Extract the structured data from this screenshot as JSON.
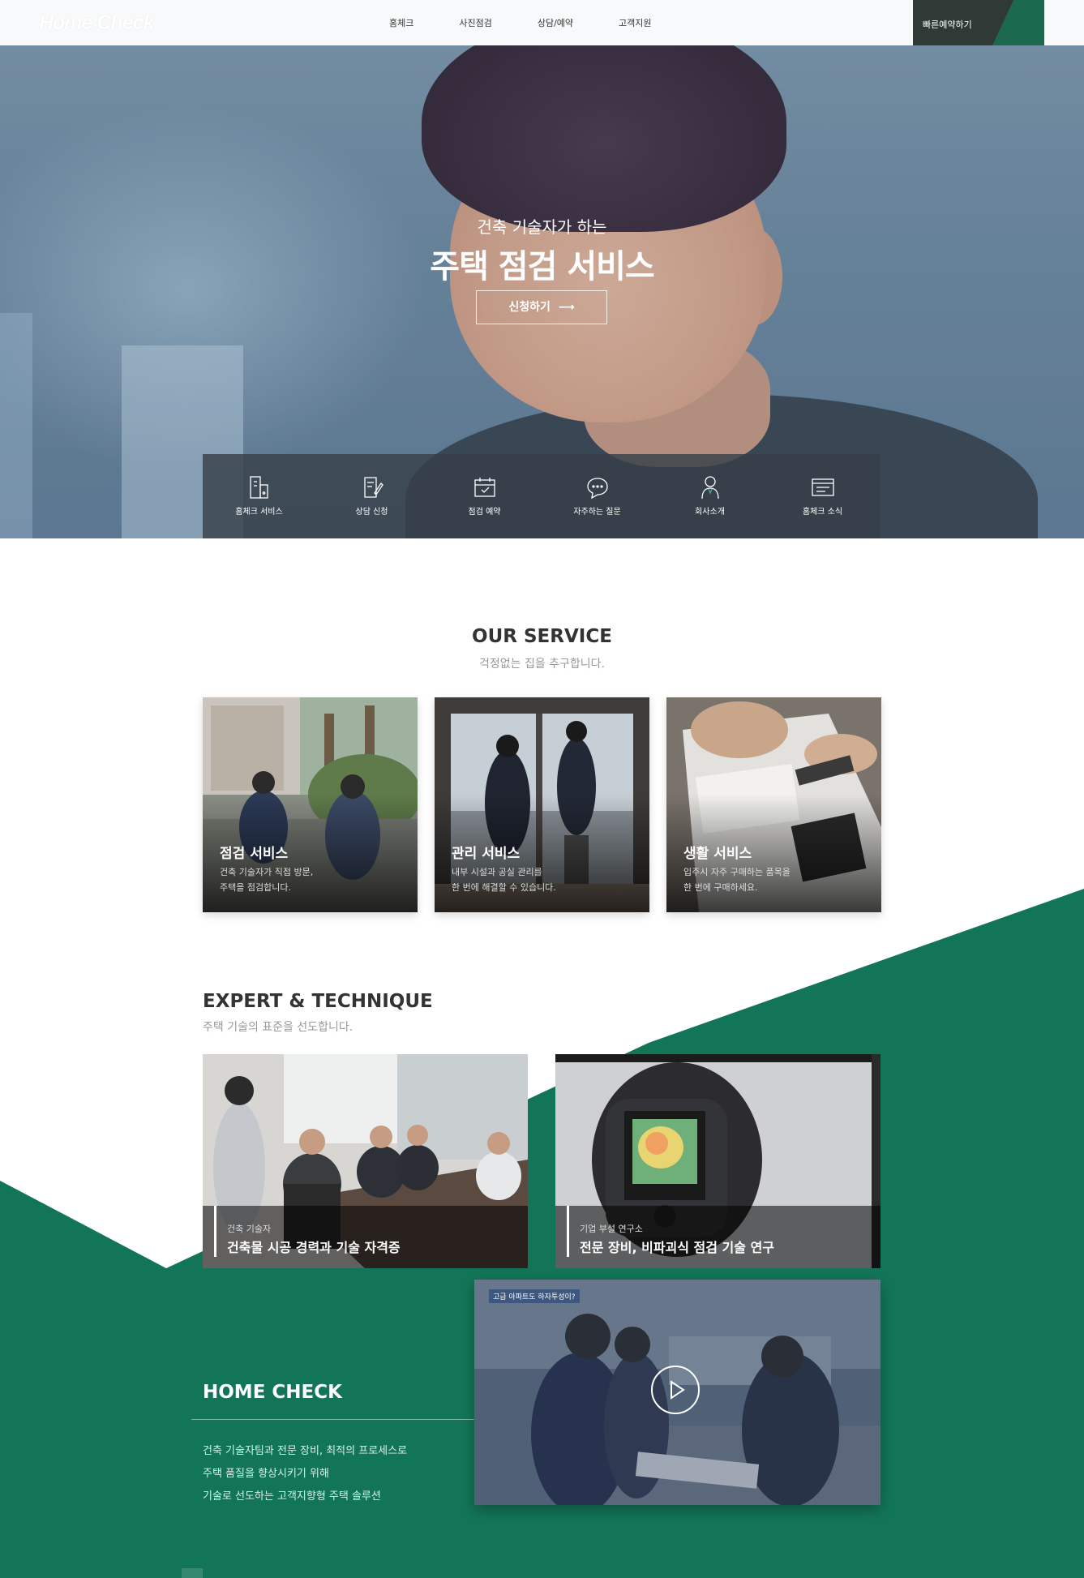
{
  "header": {
    "logo": "Home Check",
    "nav": [
      "홈체크",
      "사진점검",
      "상담/예약",
      "고객지원"
    ],
    "quick_reserve": "빠른예약하기"
  },
  "hero": {
    "subtitle": "건축 기술자가 하는",
    "title": "주택 점검 서비스",
    "button": "신청하기",
    "quick_menu": [
      {
        "label": "홈체크 서비스",
        "icon": "building-phone-icon"
      },
      {
        "label": "상담 신청",
        "icon": "document-pen-icon"
      },
      {
        "label": "점검 예약",
        "icon": "calendar-icon"
      },
      {
        "label": "자주하는 질문",
        "icon": "chat-bubble-icon"
      },
      {
        "label": "회사소개",
        "icon": "person-icon"
      },
      {
        "label": "홈체크 소식",
        "icon": "news-board-icon"
      }
    ]
  },
  "service": {
    "title": "OUR SERVICE",
    "subtitle": "걱정없는 집을 추구합니다.",
    "cards": [
      {
        "title": "점검 서비스",
        "desc1": "건축 기술자가 직접 방문,",
        "desc2": "주택을 점검합니다."
      },
      {
        "title": "관리 서비스",
        "desc1": "내부 시설과 공실 관리를",
        "desc2": "한 번에 해결할 수 있습니다."
      },
      {
        "title": "생활 서비스",
        "desc1": "입주시 자주 구매하는 품목을",
        "desc2": "한 번에 구매하세요."
      }
    ]
  },
  "expert": {
    "title": "EXPERT & TECHNIQUE",
    "subtitle": "주택 기술의 표준을 선도합니다.",
    "cards": [
      {
        "small": "건축 기술자",
        "big": "건축물 시공 경력과 기술 자격증"
      },
      {
        "small": "기업 부설 연구소",
        "big": "전문 장비, 비파괴식 점검 기술 연구"
      }
    ]
  },
  "homecheck": {
    "title": "HOME CHECK",
    "lines": [
      "건축 기술자팀과 전문 장비, 최적의 프로세스로",
      "주택 품질을 향상시키기 위해",
      "기술로 선도하는 고객지향형 주택 솔루션"
    ],
    "video_tag": "고급 아파트도 하자투성이?"
  },
  "colors": {
    "brand_green": "#137558",
    "dark": "#2f3a36",
    "text_gray": "#999999"
  }
}
